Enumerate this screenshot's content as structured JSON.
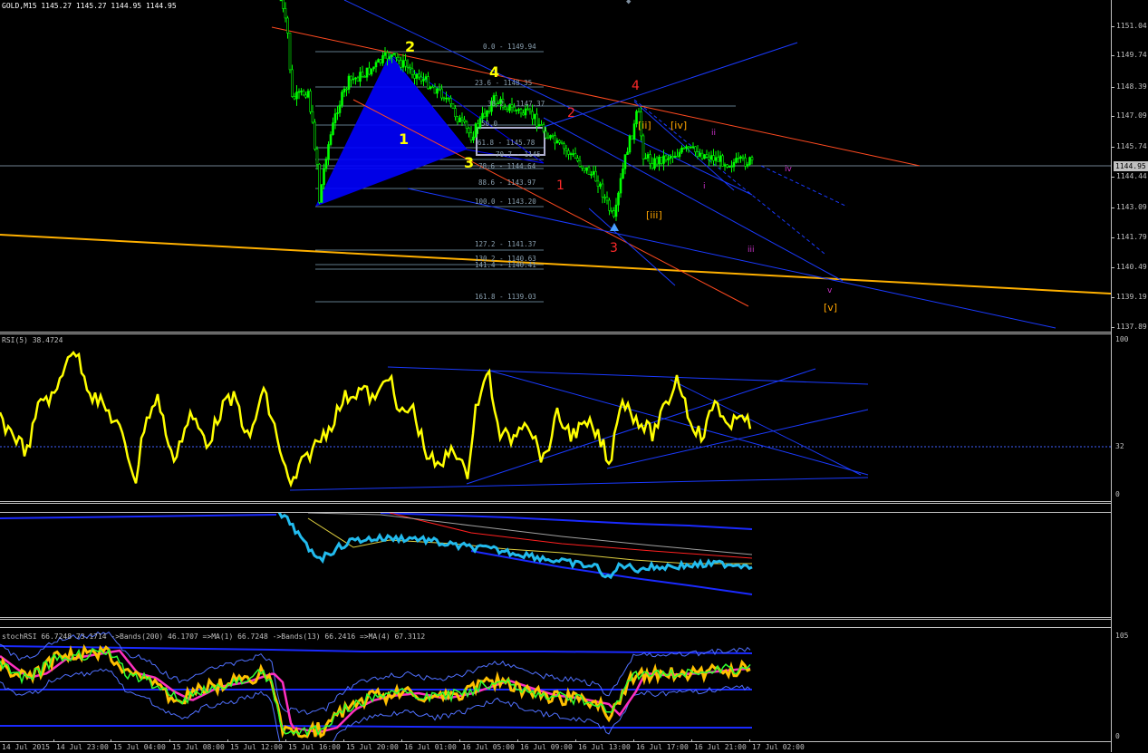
{
  "chart_header": {
    "symbol_text": "GOLD,M15  1145.27 1145.27 1144.95 1144.95"
  },
  "price_axis": {
    "labels": [
      "1151.04",
      "1149.74",
      "1148.39",
      "1147.09",
      "1145.74",
      "1144.44",
      "1143.09",
      "1141.79",
      "1140.49",
      "1139.19",
      "1137.89"
    ],
    "current_price": "1144.95"
  },
  "fib_levels": [
    {
      "text": "0.0 - 1149.94"
    },
    {
      "text": "23.6 - 1148.35"
    },
    {
      "text": "38.2 - 1147.37"
    },
    {
      "text": "50.0"
    },
    {
      "text": "61.8 - 1145.78"
    },
    {
      "text": "70.7 - 1145"
    },
    {
      "text": "78.6 - 1144.64"
    },
    {
      "text": "88.6 - 1143.97"
    },
    {
      "text": "100.0 - 1143.20"
    },
    {
      "text": "127.2 - 1141.37"
    },
    {
      "text": "130.2 - 1140.63"
    },
    {
      "text": "141.4 - 1140.41"
    },
    {
      "text": "161.8 - 1139.03"
    }
  ],
  "wave_labels": {
    "y1": "1",
    "y2": "2",
    "y3": "3",
    "y4": "4",
    "r1": "1",
    "r2": "2",
    "r3": "3",
    "r4": "4",
    "o_ii": "[ii]",
    "o_iii": "[iii]",
    "o_iv": "[iv]",
    "o_v": "[v]",
    "m_i": "i",
    "m_ii": "ii",
    "m_iii": "iii",
    "m_iv": "iv",
    "m_v": "v"
  },
  "rsi_panel": {
    "label": "RSI(5) 38.4724",
    "scale_top": "100",
    "scale_mid": "32",
    "scale_bottom": "0"
  },
  "stoch_panel": {
    "label": "stochRSI 66.7248 73.1714  ->Bands(200) 46.1707  =>MA(1) 66.7248  ->Bands(13) 66.2416  =>MA(4) 67.3112",
    "scale_top": "105",
    "scale_bottom": "0"
  },
  "time_axis": {
    "labels": [
      "14 Jul 2015",
      "14 Jul 23:00",
      "15 Jul 04:00",
      "15 Jul 08:00",
      "15 Jul 12:00",
      "15 Jul 16:00",
      "15 Jul 20:00",
      "16 Jul 01:00",
      "16 Jul 05:00",
      "16 Jul 09:00",
      "16 Jul 13:00",
      "16 Jul 17:00",
      "16 Jul 21:00",
      "17 Jul 02:00"
    ]
  },
  "colors": {
    "bull_candle": "#00ff00",
    "bear_candle": "#00ff00",
    "rsi_line": "#ffff00",
    "trend_blue": "#0000ff",
    "fib_line": "#6f8a9a",
    "wave_yellow": "#ffff00",
    "wave_red": "#ff2a2a",
    "wave_orange": "#ffa500",
    "wave_magenta": "#cc33cc",
    "panel3_main": "#22bbee"
  }
}
